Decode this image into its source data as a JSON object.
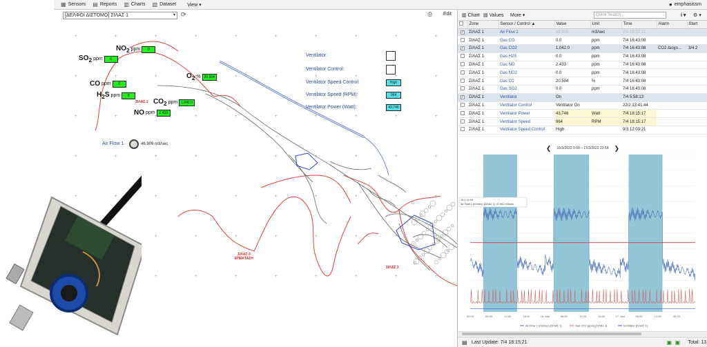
{
  "toolbar": {
    "sensors": "Sensors",
    "reports": "Reports",
    "charts": "Charts",
    "dataset": "Dataset",
    "view": "View ▾",
    "user": "emphasissm"
  },
  "map": {
    "zone_select": "[ΔΕΛΦΟΙ ΔΙΣΤΟΜΟ] ΣΙΛΑΣ 1",
    "edit": "Edit",
    "sensors": {
      "no2": {
        "label": "NO",
        "sub": "2",
        "unit": "ppm",
        "value": "0"
      },
      "so2": {
        "label": "SO",
        "sub": "2",
        "unit": "ppm",
        "value": "0"
      },
      "co": {
        "label": "CO",
        "unit": "ppm",
        "value": "0"
      },
      "h2s": {
        "label": "H",
        "sub": "2",
        "label2": "S",
        "unit": "ppm",
        "value": "0"
      },
      "co2": {
        "label": "CO",
        "sub": "2",
        "unit": "ppm",
        "value": "1,042.0"
      },
      "no": {
        "label": "NO",
        "unit": "ppm",
        "value": "2.433"
      },
      "o2": {
        "label": "O",
        "sub": "2",
        "unit": "%",
        "value": "20.504"
      }
    },
    "labels": {
      "silas1": "ΣΙΛΑΣ 1",
      "silas3_ext": "ΣΙΛΑΣ 3\nΕΠΕΚΤΑΣΗ",
      "silas3": "ΣΙΛΑΣ 3"
    },
    "ventilator": {
      "ventilator": "Ventilator:",
      "control": "Ventilator Control:",
      "speed_control": "Ventilator Speed Control:",
      "speed_control_val": "High",
      "speed": "Ventilator Speed (RPM):",
      "speed_val": "964",
      "power": "Ventilator Power (Watt):",
      "power_val": "43,746"
    },
    "airflow": {
      "label": "Air Flow 1",
      "value": "46.909 m3/sec"
    }
  },
  "panel": {
    "tabs": {
      "chart": "Chart",
      "values": "Values",
      "more": "More ▾"
    },
    "search_placeholder": "Quick Search...",
    "columns": [
      "Zone",
      "Sensor / Control ▲",
      "Value",
      "Unit",
      "Time",
      "Alarm",
      "Start"
    ],
    "rows": [
      {
        "checked": true,
        "zone": "ΣΙΛΑΣ 1",
        "sensor": "Air Flow 1",
        "value": "46.909",
        "unit": "m3/sec",
        "time": "7/4 18:15:21",
        "alarm": "",
        "start": "",
        "sel": true,
        "faded": true
      },
      {
        "checked": false,
        "zone": "ΣΙΛΑΣ 1",
        "sensor": "Gas CO",
        "value": "0.0",
        "unit": "ppm",
        "time": "7/4 16:43:08",
        "alarm": "",
        "start": ""
      },
      {
        "checked": true,
        "zone": "ΣΙΛΑΣ 1",
        "sensor": "Gas CO2",
        "value": "1,042.0",
        "unit": "ppm",
        "time": "7/4 16:43:08",
        "alarm": "CO2 Διοχο...",
        "start": "3/4 2",
        "sel": true
      },
      {
        "checked": false,
        "zone": "ΣΙΛΑΣ 1",
        "sensor": "Gas H2S",
        "value": "0.0",
        "unit": "ppm",
        "time": "7/4 16:43:08",
        "alarm": "",
        "start": ""
      },
      {
        "checked": false,
        "zone": "ΣΙΛΑΣ 1",
        "sensor": "Gas NO",
        "value": "2.433",
        "unit": "ppm",
        "time": "7/4 16:43:08",
        "alarm": "",
        "start": ""
      },
      {
        "checked": false,
        "zone": "ΣΙΛΑΣ 1",
        "sensor": "Gas NO2",
        "value": "0.0",
        "unit": "ppm",
        "time": "7/4 16:43:08",
        "alarm": "",
        "start": ""
      },
      {
        "checked": false,
        "zone": "ΣΙΛΑΣ 1",
        "sensor": "Gas O2",
        "value": "20.504",
        "unit": "%",
        "time": "7/4 16:43:08",
        "alarm": "",
        "start": ""
      },
      {
        "checked": false,
        "zone": "ΣΙΛΑΣ 1",
        "sensor": "Gas SO2",
        "value": "0.0",
        "unit": "ppm",
        "time": "7/4 16:43:08",
        "alarm": "",
        "start": ""
      },
      {
        "checked": true,
        "zone": "ΣΙΛΑΣ 1",
        "sensor": "Ventilator",
        "value": "On",
        "unit": "",
        "time": "7/4 5:58:13",
        "alarm": "",
        "start": "",
        "sel": true
      },
      {
        "checked": false,
        "zone": "ΣΙΛΑΣ 1",
        "sensor": "Ventilator Control",
        "value": "Ventilator On",
        "unit": "",
        "time": "22/2 13:41:44",
        "alarm": "",
        "start": ""
      },
      {
        "checked": false,
        "zone": "ΣΙΛΑΣ 1",
        "sensor": "Ventilator Power",
        "value": "43,746",
        "unit": "Watt",
        "time": "7/4 18:15:17",
        "alarm": "",
        "start": "",
        "hl": true
      },
      {
        "checked": false,
        "zone": "ΣΙΛΑΣ 1",
        "sensor": "Ventilator Speed",
        "value": "964",
        "unit": "RPM",
        "time": "7/4 18:15:17",
        "alarm": "",
        "start": "",
        "hl": true
      },
      {
        "checked": false,
        "zone": "ΣΙΛΑΣ 1",
        "sensor": "Ventilator Speed Control",
        "value": "High",
        "unit": "",
        "time": "9/3 12:03:21",
        "alarm": "",
        "start": ""
      }
    ],
    "chart_range": "15/3/2022 0:00 – 17/3/2022 23:59",
    "last_update": "Last Update: 7/4 18:15:21",
    "total": "Total: 13"
  },
  "chart_data": {
    "type": "line",
    "x_ticks": [
      "00:00",
      "06:00",
      "12:00",
      "18:00",
      "16. Mar",
      "06:00",
      "12:00",
      "18:00",
      "17. Mar",
      "06:00",
      "12:00",
      "18:00"
    ],
    "series": [
      {
        "name": "Air Flow 1 (m3/sec) [ΣΙΛΑΣ 1]",
        "color": "#5577bb",
        "levels": [
          {
            "from": 0,
            "to": 4.2,
            "v": 0.32
          },
          {
            "from": 4.2,
            "to": 15,
            "v": 0.62
          },
          {
            "from": 15,
            "to": 24,
            "v": 0.32
          },
          {
            "from": 24,
            "to": 26.7,
            "v": 0.34
          },
          {
            "from": 26.7,
            "to": 38,
            "v": 0.62
          },
          {
            "from": 38,
            "to": 48,
            "v": 0.3
          },
          {
            "from": 48,
            "to": 50.7,
            "v": 0.33
          },
          {
            "from": 50.7,
            "to": 61.5,
            "v": 0.62
          },
          {
            "from": 61.5,
            "to": 72,
            "v": 0.3
          }
        ]
      },
      {
        "name": "Gas CO2 (ppm) [ΣΙΛΑΣ 1]",
        "color": "#cc6666",
        "levels": [
          {
            "from": 0,
            "to": 72,
            "v": 0.06
          }
        ]
      },
      {
        "name": "Ventilator [ΣΙΛΑΣ 1]",
        "color": "#3366cc",
        "levels": [
          {
            "from": 0,
            "to": 72,
            "v": 0.02
          }
        ]
      }
    ],
    "on_bands": [
      [
        4.2,
        15
      ],
      [
        26.7,
        38
      ],
      [
        50.7,
        61.5
      ]
    ],
    "threshold": 0.44,
    "tooltip": {
      "title": "15.3 04:56",
      "text": "Air Flow 1 (m3/sec) [ΣΙΛΑΣ 1]: 47.962 m3/sec"
    },
    "band_color": "#7fbcd0",
    "threshold_color": "#d04040"
  }
}
